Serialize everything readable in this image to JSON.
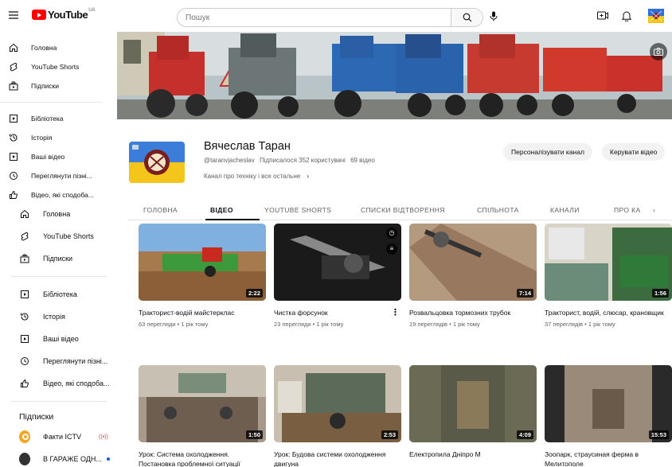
{
  "header": {
    "logo_text": "YouTube",
    "logo_region": "UA",
    "search_placeholder": "Пошук"
  },
  "sidebar_top": [
    {
      "label": "Головна",
      "icon": "home-icon"
    },
    {
      "label": "YouTube Shorts",
      "icon": "shorts-icon"
    },
    {
      "label": "Підписки",
      "icon": "subscriptions-icon"
    },
    {
      "label": "Бібліотека",
      "icon": "library-icon"
    },
    {
      "label": "Історія",
      "icon": "history-icon"
    },
    {
      "label": "Ваші відео",
      "icon": "your-videos-icon"
    },
    {
      "label": "Переглянути пізні...",
      "icon": "watch-later-icon"
    },
    {
      "label": "Відео, які сподоба...",
      "icon": "liked-icon"
    }
  ],
  "sidebar_overlay": {
    "items": [
      {
        "label": "Головна",
        "icon": "home-icon"
      },
      {
        "label": "YouTube Shorts",
        "icon": "shorts-icon"
      },
      {
        "label": "Підписки",
        "icon": "subscriptions-icon"
      },
      {
        "label": "Бібліотека",
        "icon": "library-icon"
      },
      {
        "label": "Історія",
        "icon": "history-icon"
      },
      {
        "label": "Ваші відео",
        "icon": "your-videos-icon"
      },
      {
        "label": "Переглянути пізні...",
        "icon": "watch-later-icon"
      },
      {
        "label": "Відео, які сподоба...",
        "icon": "liked-icon"
      }
    ],
    "subscriptions_heading": "Підписки",
    "subscriptions": [
      {
        "label": "Факти ICTV",
        "avatar_color": "#f5a623"
      },
      {
        "label": "В ГАРАЖЕ ОДН...",
        "avatar_color": "#333333"
      }
    ]
  },
  "channel": {
    "name": "Вячеслав Таран",
    "handle": "@taranvjacheslav",
    "subscribers": "Підписалося 352 користувачі",
    "videos_count": "69 відео",
    "description": "Канал про техніку і все остальне",
    "customize_button": "Персоналізувати канал",
    "manage_button": "Керувати відео"
  },
  "tabs": [
    "ГОЛОВНА",
    "ВІДЕО",
    "YOUTUBE SHORTS",
    "СПИСКИ ВІДТВОРЕННЯ",
    "СПІЛЬНОТА",
    "КАНАЛИ",
    "ПРО КА"
  ],
  "active_tab": "ВІДЕО",
  "videos": [
    {
      "title": "Тракторист-водій майстерклас",
      "meta": "63 перегляди • 1 рік тому",
      "duration": "2:22"
    },
    {
      "title": "Чистка форсунок",
      "meta": "23 перегляди • 1 рік тому",
      "duration": ""
    },
    {
      "title": "Розвальцовка тормозних трубок",
      "meta": "19 переглядів • 1 рік тому",
      "duration": "7:14"
    },
    {
      "title": "Тракторист, водій, слюсар, крановщик",
      "meta": "37 переглядів • 1 рік тому",
      "duration": "1:56"
    },
    {
      "title": "Урок: Система охолодження. Постановка проблемної ситуації",
      "meta": "",
      "duration": "1:50"
    },
    {
      "title": "Урок: Будова системи охолодження двигуна",
      "meta": "",
      "duration": "2:53"
    },
    {
      "title": "Електропила Дніпро М",
      "meta": "",
      "duration": "4:09"
    },
    {
      "title": "Зоопарк, страусиная ферма в Мелитополе",
      "meta": "",
      "duration": "15:53"
    }
  ],
  "colors": {
    "accent": "#ff0000",
    "text": "#0f0f0f",
    "muted": "#606060"
  }
}
